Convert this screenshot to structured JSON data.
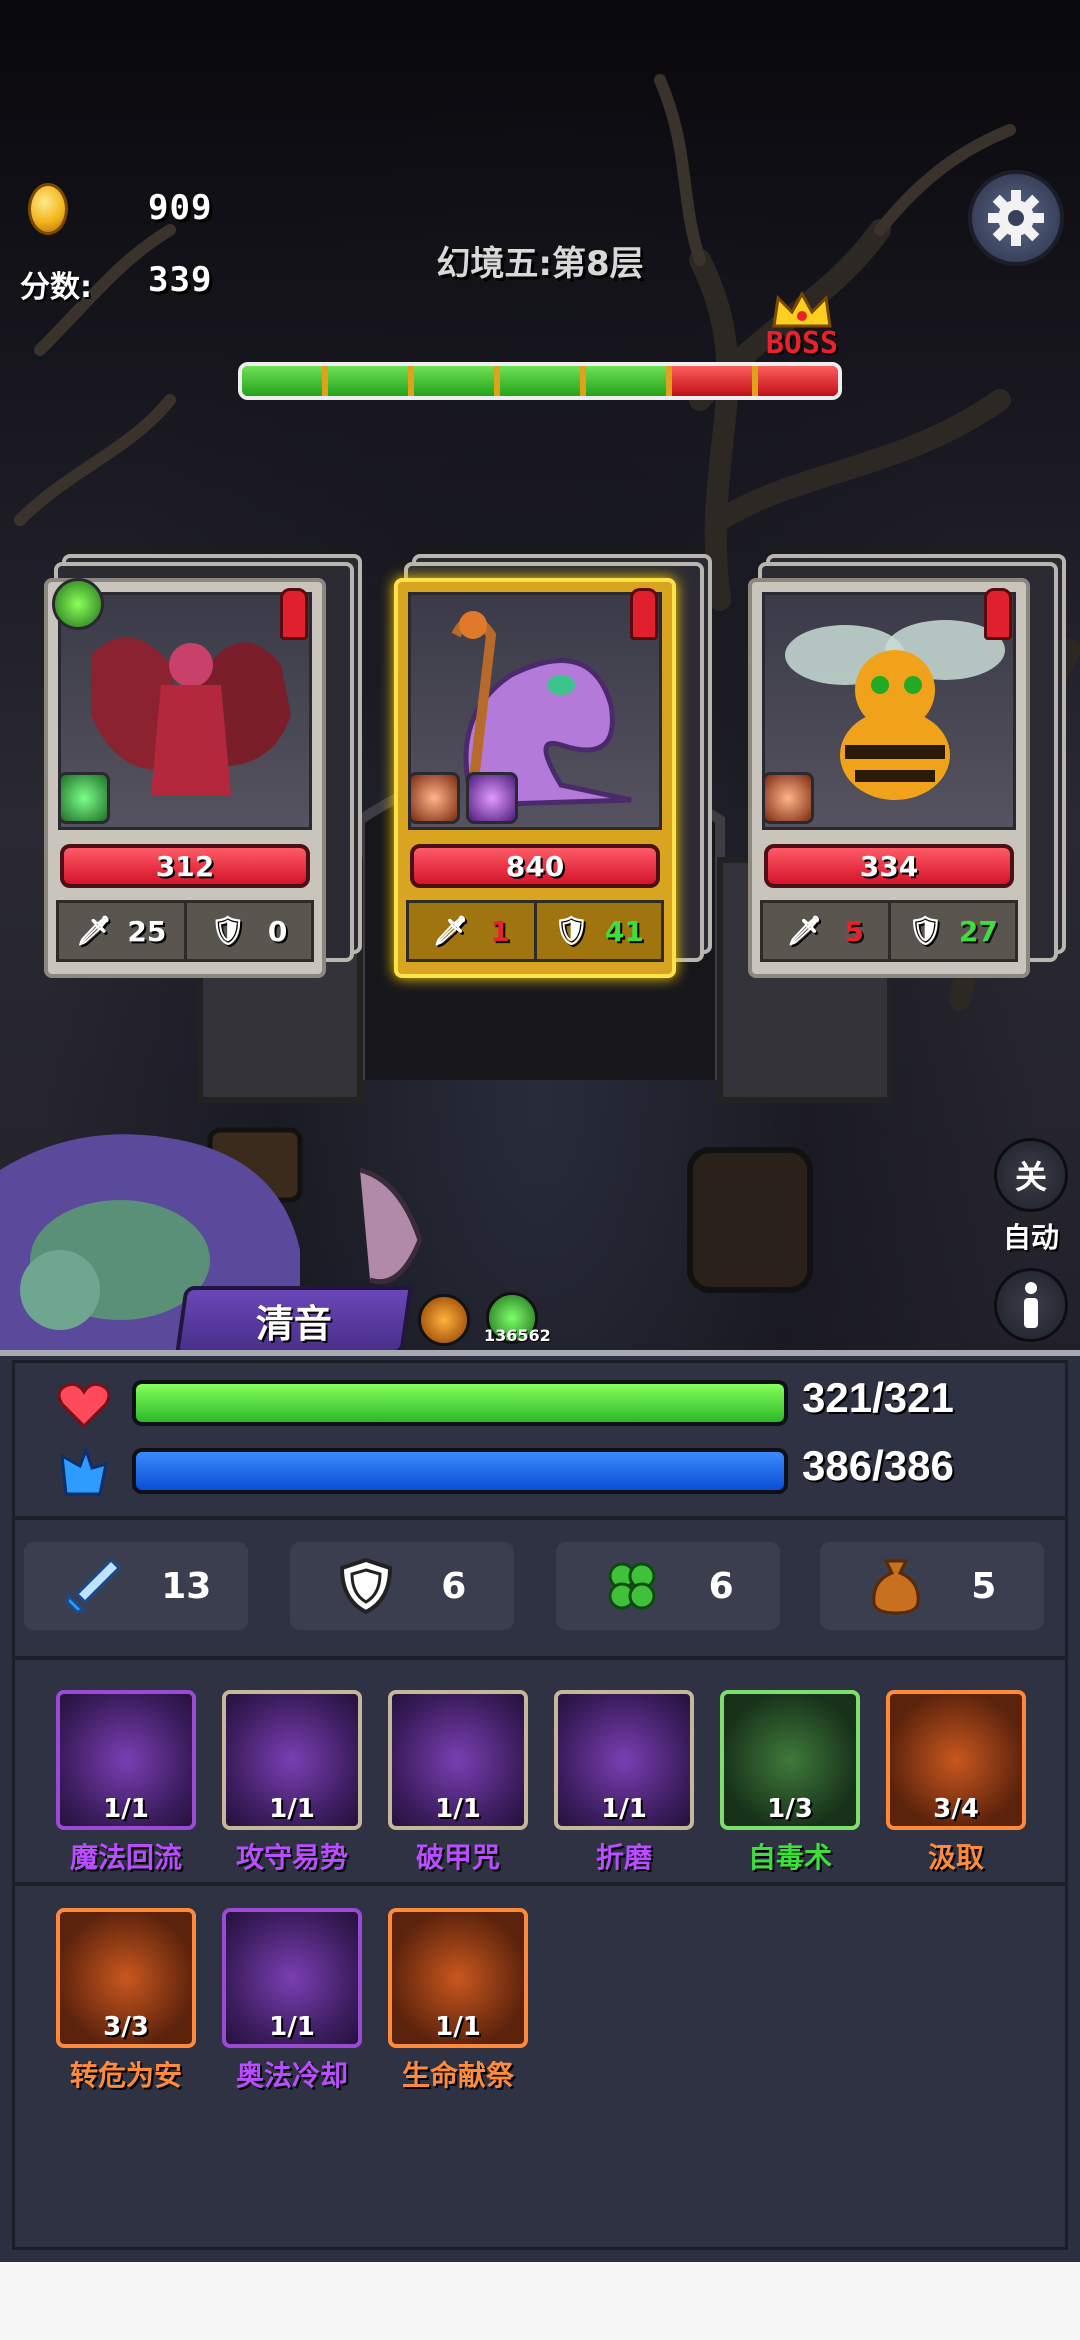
{
  "hud": {
    "gold": "909",
    "score_label": "分数:",
    "score": "339",
    "level_title": "幻境五:第8层",
    "boss_label": "BOSS"
  },
  "progress": {
    "segments_total": 7,
    "segments_cleared": 5
  },
  "enemies": [
    {
      "name": "",
      "hp": "312",
      "atk": "25",
      "def": "0",
      "atk_color": "#ffffff",
      "def_color": "#ffffff"
    },
    {
      "name": "",
      "hp": "840",
      "atk": "1",
      "def": "41",
      "atk_color": "#e8212b",
      "def_color": "#3be03b"
    },
    {
      "name": "",
      "hp": "334",
      "atk": "5",
      "def": "27",
      "atk_color": "#e8212b",
      "def_color": "#3be03b"
    }
  ],
  "side": {
    "auto_toggle": "关",
    "auto_label": "自动"
  },
  "hero": {
    "name": "清音",
    "buff_count": "136562"
  },
  "player": {
    "hp_text": "321/321",
    "hp_fraction": 1.0,
    "mp_text": "386/386",
    "mp_fraction": 1.0,
    "attack": "13",
    "defense": "6",
    "luck": "6",
    "bag": "5"
  },
  "skills": [
    {
      "name": "魔法回流",
      "count": "1/1",
      "color": "#b94dff"
    },
    {
      "name": "攻守易势",
      "count": "1/1",
      "color": "#b94dff"
    },
    {
      "name": "破甲咒",
      "count": "1/1",
      "color": "#b94dff"
    },
    {
      "name": "折磨",
      "count": "1/1",
      "color": "#b94dff"
    },
    {
      "name": "自毒术",
      "count": "1/3",
      "color": "#3be03b"
    },
    {
      "name": "汲取",
      "count": "3/4",
      "color": "#ff8a3a"
    },
    {
      "name": "转危为安",
      "count": "3/3",
      "color": "#ff8a3a"
    },
    {
      "name": "奥法冷却",
      "count": "1/1",
      "color": "#b94dff"
    },
    {
      "name": "生命献祭",
      "count": "1/1",
      "color": "#ff8a3a"
    }
  ]
}
